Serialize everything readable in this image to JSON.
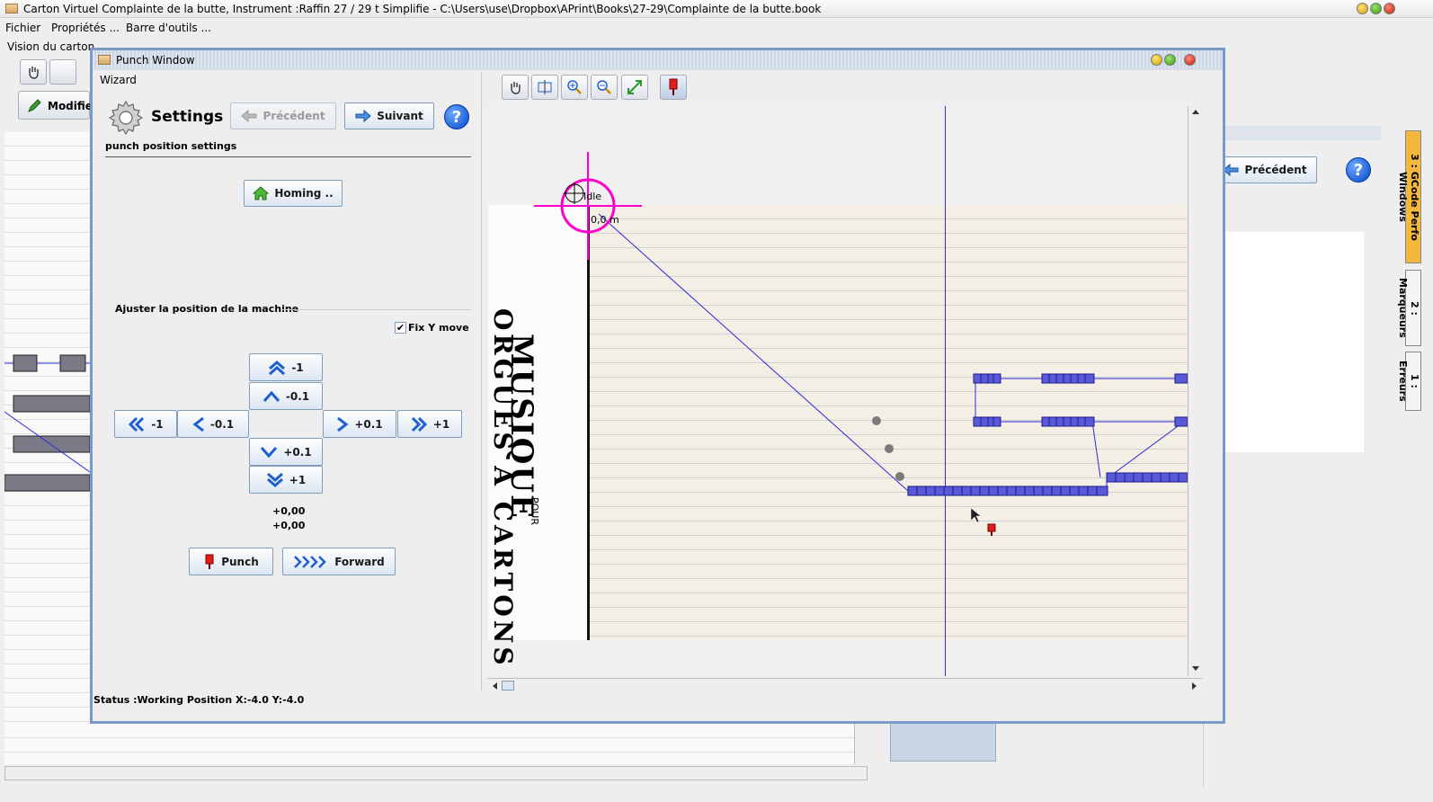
{
  "main_window": {
    "title": "Carton Virtuel  Complainte de la butte, Instrument :Raffin 27 / 29 t Simplifie - C:\\Users\\use\\Dropbox\\APrint\\Books\\27-29\\Complainte de la butte.book",
    "menu": [
      "Fichier",
      "Propriétés ...",
      "Barre d'outils ..."
    ],
    "vision_label": "Vision du carton",
    "modifier_label": "Modifier"
  },
  "side_tabs": [
    {
      "label": "3 : GCode Perfo Windows",
      "selected": true
    },
    {
      "label": "2 : Marqueurs",
      "selected": false
    },
    {
      "label": "1 : Erreurs",
      "selected": false
    }
  ],
  "right_panel": {
    "precedent_label": "Précédent",
    "help_label": "?"
  },
  "punch_window": {
    "title": "Punch Window",
    "wizard_label": "Wizard",
    "settings_title": "Settings",
    "settings_subtitle": "punch position settings",
    "precedent_button": "Précédent",
    "suivant_button": "Suivant",
    "help_button": "?",
    "homing_button": "Homing ..",
    "adjust_label": "Ajuster la position de la machine",
    "fix_y_label": "Fix Y move",
    "fix_y_checked": true,
    "moves": {
      "up1": "-1",
      "up01": "-0.1",
      "left1": "-1",
      "left01": "-0.1",
      "right01": "+0.1",
      "right1": "+1",
      "down01": "+0.1",
      "down1": "+1"
    },
    "offset_x": "+0,00",
    "offset_y": "+0,00",
    "punch_button": "Punch",
    "forward_button": "Forward",
    "status": "Status :Working Position X:-4.0  Y:-4.0",
    "canvas": {
      "cursor_state": "Idle",
      "origin_label": "0,0 m",
      "card_text_main": "MUSIQUE",
      "card_text_sub": "ORGUES A CARTONS",
      "card_text_pour": "POUR",
      "accent_magenta": "#ff00cc",
      "path_blue": "#2b2bd6"
    }
  }
}
